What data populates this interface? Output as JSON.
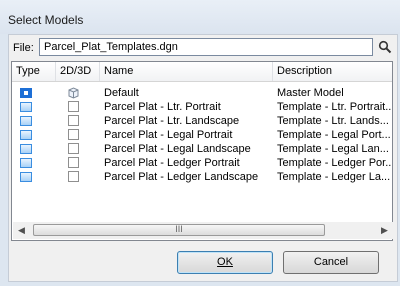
{
  "window": {
    "title": "Select Models"
  },
  "file": {
    "label": "File:",
    "value": "Parcel_Plat_Templates.dgn"
  },
  "list": {
    "columns": [
      "Type",
      "2D/3D",
      "Name",
      "Description"
    ],
    "rows": [
      {
        "type_icon": "active-model-icon",
        "dim_icon": "3d-cube-icon",
        "name": "Default",
        "description": "Master Model"
      },
      {
        "type_icon": "sheet-template-icon",
        "dim_icon": "2d-square-icon",
        "name": "Parcel Plat - Ltr. Portrait",
        "description": "Template - Ltr. Portrait..."
      },
      {
        "type_icon": "sheet-template-icon",
        "dim_icon": "2d-square-icon",
        "name": "Parcel Plat - Ltr. Landscape",
        "description": "Template - Ltr. Lands..."
      },
      {
        "type_icon": "sheet-template-icon",
        "dim_icon": "2d-square-icon",
        "name": "Parcel Plat - Legal Portrait",
        "description": "Template - Legal Port..."
      },
      {
        "type_icon": "sheet-template-icon",
        "dim_icon": "2d-square-icon",
        "name": "Parcel Plat - Legal Landscape",
        "description": "Template - Legal Lan..."
      },
      {
        "type_icon": "sheet-template-icon",
        "dim_icon": "2d-square-icon",
        "name": "Parcel Plat - Ledger Portrait",
        "description": "Template - Ledger Por..."
      },
      {
        "type_icon": "sheet-template-icon",
        "dim_icon": "2d-square-icon",
        "name": "Parcel Plat - Ledger Landscape",
        "description": "Template - Ledger La..."
      }
    ]
  },
  "scrollbar": {
    "thumb_grip": "III"
  },
  "buttons": {
    "ok": "OK",
    "cancel": "Cancel"
  },
  "colors": {
    "accent": "#1d6fd6",
    "title_bg": "#dde6f0"
  }
}
